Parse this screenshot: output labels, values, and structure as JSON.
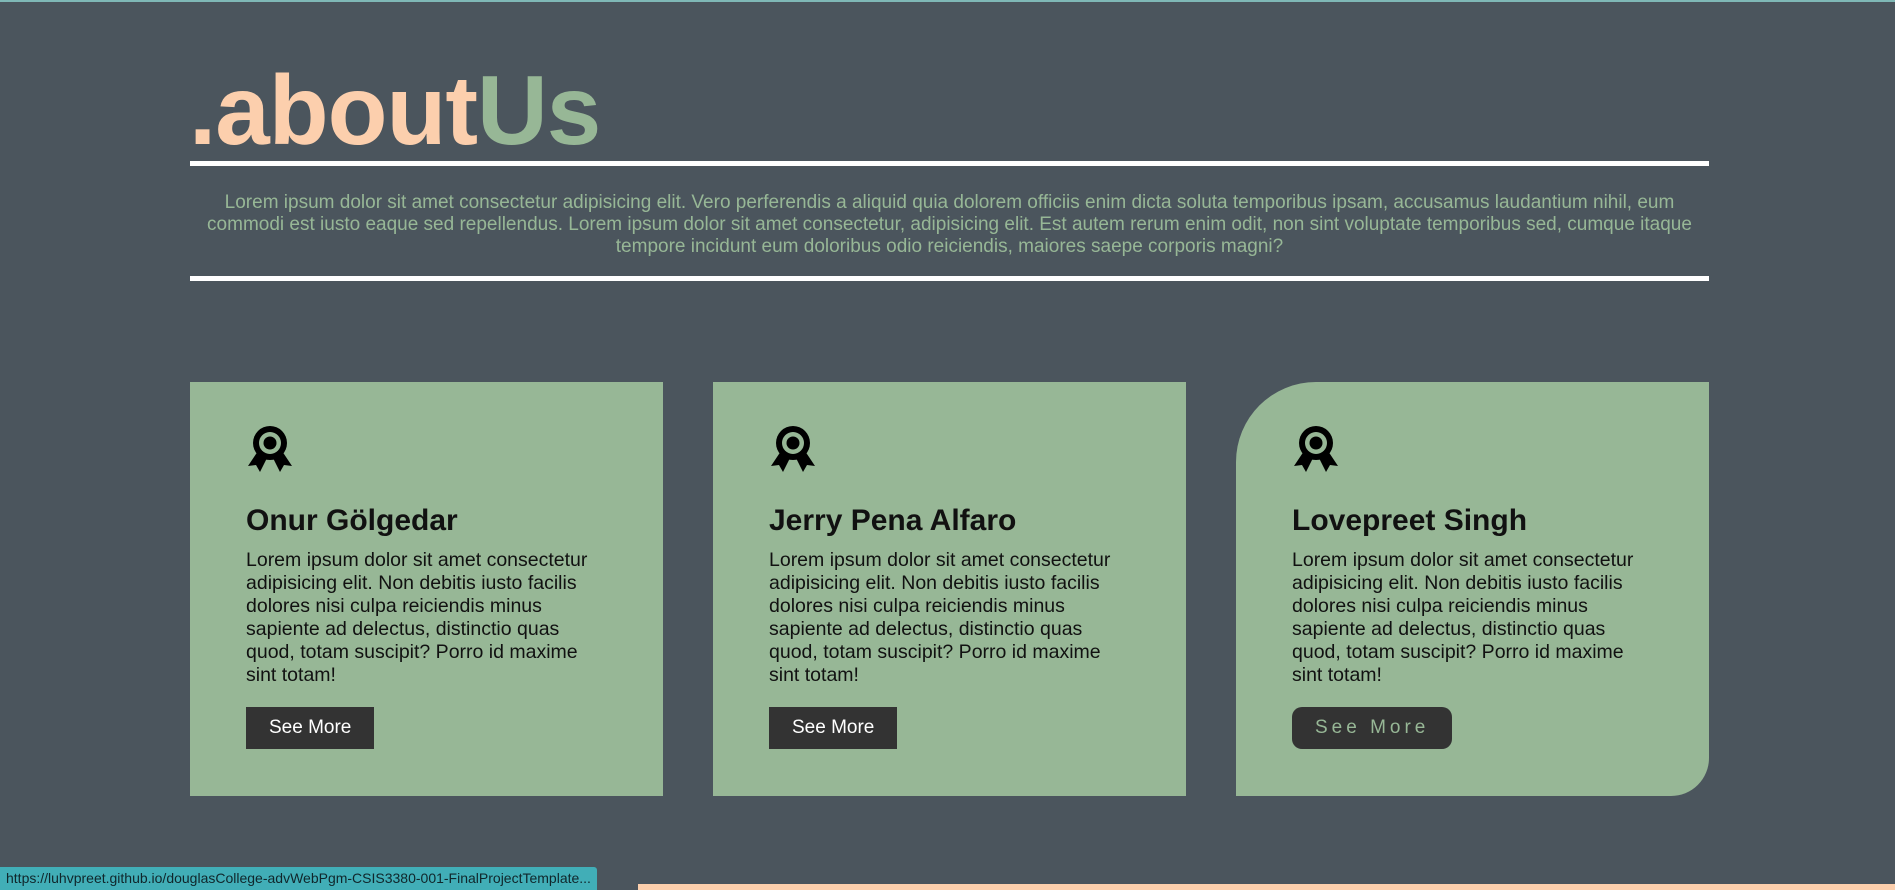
{
  "page": {
    "title_part_1": ".about",
    "title_part_2": "Us",
    "intro_text": "Lorem ipsum dolor sit amet consectetur adipisicing elit. Vero perferendis a aliquid quia dolorem officiis enim dicta soluta temporibus ipsam, accusamus laudantium nihil, eum commodi est iusto eaque sed repellendus. Lorem ipsum dolor sit amet consectetur, adipisicing elit. Est autem rerum enim odit, non sint voluptate temporibus sed, cumque itaque tempore incidunt eum doloribus odio reiciendis, maiores saepe corporis magni?"
  },
  "cards": [
    {
      "icon": "award-ribbon-icon",
      "name": "Onur Gölgedar",
      "text": "Lorem ipsum dolor sit amet consectetur adipisicing elit. Non debitis iusto facilis dolores nisi culpa reiciendis minus sapiente ad delectus, distinctio quas quod, totam suscipit? Porro id maxime sint totam!",
      "button_label": "See More"
    },
    {
      "icon": "award-ribbon-icon",
      "name": "Jerry Pena Alfaro",
      "text": "Lorem ipsum dolor sit amet consectetur adipisicing elit. Non debitis iusto facilis dolores nisi culpa reiciendis minus sapiente ad delectus, distinctio quas quod, totam suscipit? Porro id maxime sint totam!",
      "button_label": "See More"
    },
    {
      "icon": "award-ribbon-icon",
      "name": "Lovepreet Singh",
      "text": "Lorem ipsum dolor sit amet consectetur adipisicing elit. Non debitis iusto facilis dolores nisi culpa reiciendis minus sapiente ad delectus, distinctio quas quod, totam suscipit? Porro id maxime sint totam!",
      "button_label": "See More"
    }
  ],
  "status_bar": {
    "url": "https://luhvpreet.github.io/douglasCollege-advWebPgm-CSIS3380-001-FinalProjectTemplate..."
  },
  "colors": {
    "background": "#4b555d",
    "accent_peach": "#fccfad",
    "accent_green": "#97b796",
    "button_dark": "#333333",
    "status_bar": "#41aeb7"
  }
}
